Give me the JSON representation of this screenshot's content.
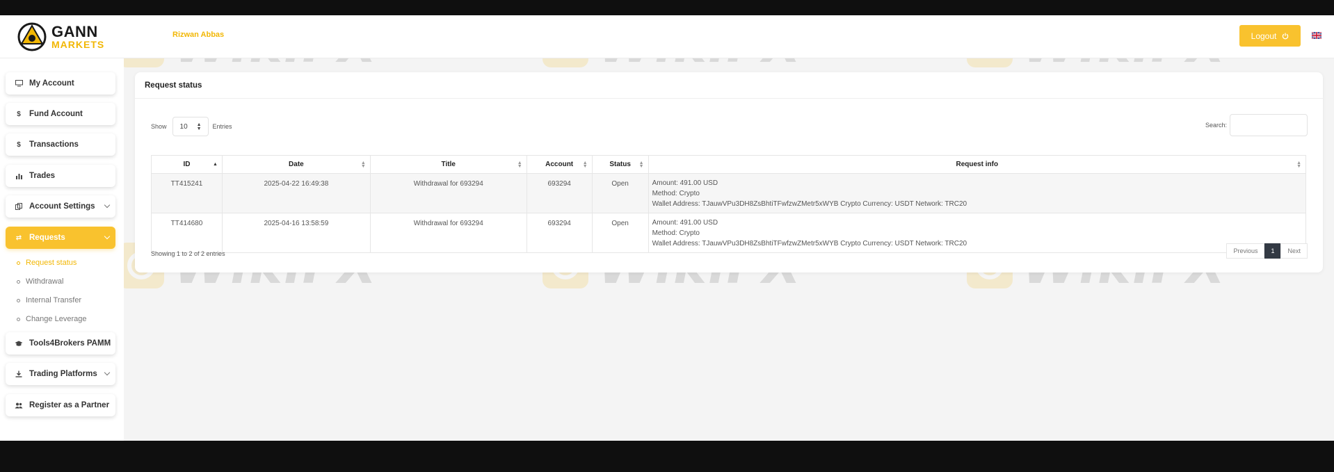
{
  "header": {
    "logo_top": "GANN",
    "logo_bottom": "MARKETS",
    "username": "Rizwan Abbas",
    "logout_label": "Logout"
  },
  "sidebar": {
    "items": [
      {
        "label": "My Account",
        "icon": "monitor-icon"
      },
      {
        "label": "Fund Account",
        "icon": "dollar-icon"
      },
      {
        "label": "Transactions",
        "icon": "dollar-icon"
      },
      {
        "label": "Trades",
        "icon": "bar-chart-icon"
      },
      {
        "label": "Account Settings",
        "icon": "copy-icon"
      },
      {
        "label": "Requests",
        "icon": "exchange-icon"
      },
      {
        "label": "Tools4Brokers PAMM",
        "icon": "graduation-cap-icon"
      },
      {
        "label": "Trading Platforms",
        "icon": "download-icon"
      },
      {
        "label": "Register as a Partner",
        "icon": "users-icon"
      }
    ],
    "sub_items": [
      "Request status",
      "Withdrawal",
      "Internal Transfer",
      "Change Leverage"
    ]
  },
  "main": {
    "title": "Request status",
    "show_label": "Show",
    "entries_label": "Entries",
    "length_value": "10",
    "search_label": "Search:",
    "columns": [
      "ID",
      "Date",
      "Title",
      "Account",
      "Status",
      "Request info"
    ],
    "rows": [
      {
        "id": "TT415241",
        "date": "2025-04-22 16:49:38",
        "title": "Withdrawal for 693294",
        "account": "693294",
        "status": "Open",
        "info_amount": "Amount: 491.00 USD",
        "info_method": "Method: Crypto",
        "info_wallet": "Wallet Address: TJauwVPu3DH8ZsBhtiTFwfzwZMetr5xWYB Crypto Currency: USDT Network: TRC20"
      },
      {
        "id": "TT414680",
        "date": "2025-04-16 13:58:59",
        "title": "Withdrawal for 693294",
        "account": "693294",
        "status": "Open",
        "info_amount": "Amount: 491.00 USD",
        "info_method": "Method: Crypto",
        "info_wallet": "Wallet Address: TJauwVPu3DH8ZsBhtiTFwfzwZMetr5xWYB Crypto Currency: USDT Network: TRC20"
      }
    ],
    "info_text": "Showing 1 to 2 of 2 entries",
    "pagination": {
      "previous": "Previous",
      "current": "1",
      "next": "Next"
    }
  },
  "watermark": "WikiFX",
  "colors": {
    "accent": "#f9c22e",
    "brand_yellow": "#f2b705",
    "pager_active": "#333a44"
  }
}
